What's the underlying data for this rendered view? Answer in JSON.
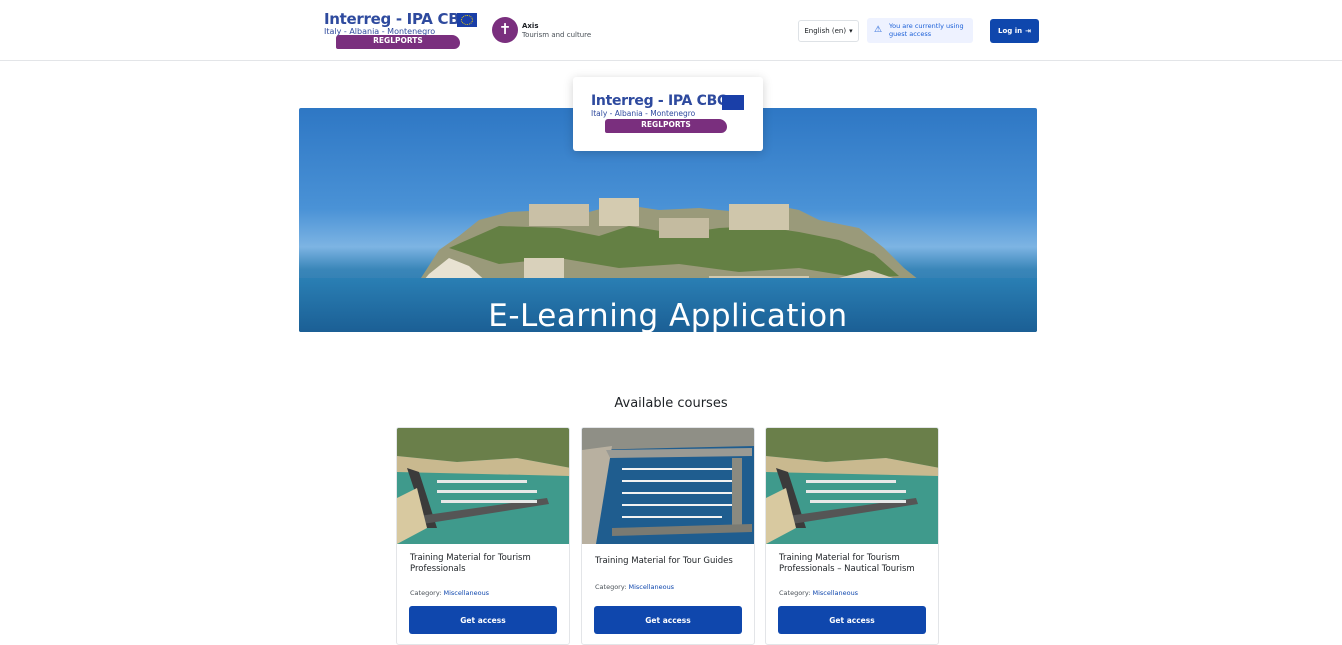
{
  "header": {
    "logo": {
      "title": "Interreg - IPA CBC",
      "subtitle": "Italy - Albania - Montenegro",
      "project": "REGLPORTS"
    },
    "site": {
      "name": "Axis",
      "tagline": "Tourism and culture"
    },
    "language": {
      "selected": "English (en)",
      "chevron": "▾"
    },
    "guest_notice": "You are currently using guest access",
    "login_label": "Log in",
    "icons": {
      "warning": "⚠",
      "login": "⇥"
    }
  },
  "hero": {
    "title": "E-Learning Application",
    "logo": {
      "title": "Interreg - IPA CBC",
      "subtitle": "Italy - Albania - Montenegro",
      "project": "REGLPORTS"
    }
  },
  "courses": {
    "heading": "Available courses",
    "category_label": "Category:",
    "items": [
      {
        "name": "Training Material for Tourism Professionals",
        "category": "Miscellaneous",
        "button": "Get access"
      },
      {
        "name": "Training Material for Tour Guides",
        "category": "Miscellaneous",
        "button": "Get access"
      },
      {
        "name": "Training Material for Tourism Professionals – Nautical Tourism",
        "category": "Miscellaneous",
        "button": "Get access"
      }
    ]
  },
  "colors": {
    "primary": "#0f47ad",
    "brand_purple": "#7a2f7e",
    "interreg_blue": "#2e4a9e",
    "sea": "#1a6a9e",
    "sky": "#4a92d6"
  }
}
